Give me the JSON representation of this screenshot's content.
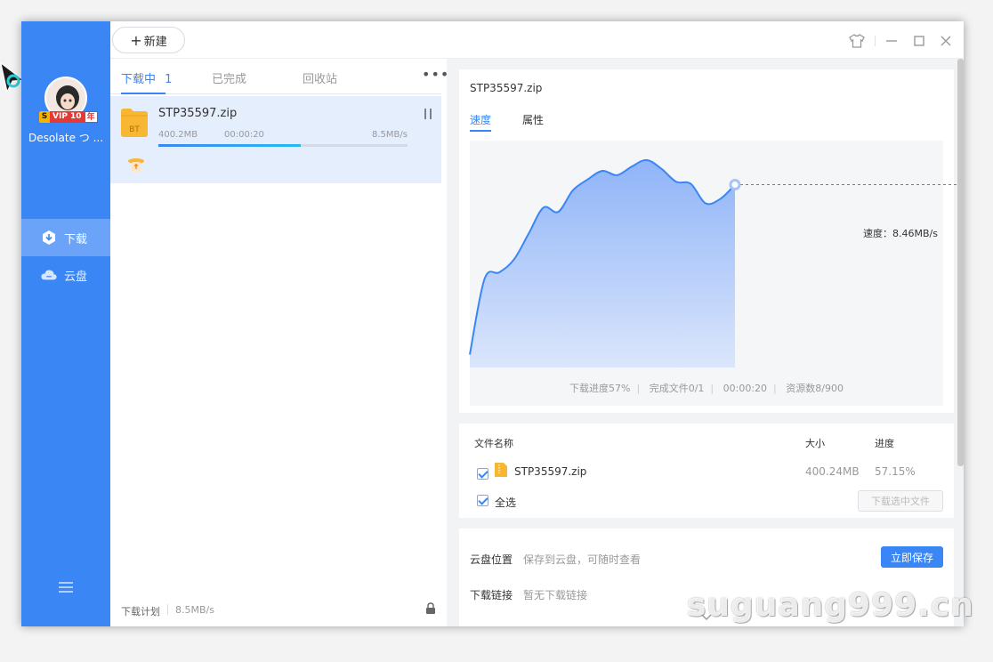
{
  "topbar": {
    "new_label": "新建"
  },
  "sidebar": {
    "username": "Desolate つ ...",
    "vip": {
      "s": "S",
      "text": "VIP 10",
      "year": "年"
    },
    "items": [
      {
        "label": "下载",
        "icon": "download-icon",
        "active": true
      },
      {
        "label": "云盘",
        "icon": "cloud-icon",
        "active": false
      }
    ]
  },
  "list": {
    "tabs": [
      {
        "label": "下载中",
        "count": "1",
        "active": true
      },
      {
        "label": "已完成",
        "active": false
      },
      {
        "label": "回收站",
        "active": false
      }
    ],
    "more": "•••",
    "item": {
      "name": "STP35597.zip",
      "size": "400.2MB",
      "time": "00:00:20",
      "speed": "8.5MB/s",
      "progress": 0.57,
      "file_badge": "BT"
    },
    "footer": {
      "plan": "下载计划",
      "speed": "8.5MB/s"
    }
  },
  "detail": {
    "title": "STP35597.zip",
    "tabs": [
      {
        "label": "速度",
        "active": true
      },
      {
        "label": "属性",
        "active": false
      }
    ],
    "speed_label": "速度：8.46MB/s",
    "stats": {
      "progress": "下载进度57%",
      "files": "完成文件0/1",
      "time": "00:00:20",
      "resources": "资源数8/900"
    },
    "files": {
      "headers": {
        "name": "文件名称",
        "size": "大小",
        "progress": "进度"
      },
      "rows": [
        {
          "name": "STP35597.zip",
          "size": "400.24MB",
          "progress": "57.15%"
        }
      ],
      "select_all": "全选",
      "download_selected": "下载选中文件"
    },
    "cloud": {
      "location_label": "云盘位置",
      "location_hint": "保存到云盘，可随时查看",
      "save_button": "立即保存",
      "link_label": "下载链接",
      "link_value": "暂无下载链接"
    }
  },
  "watermark": "suguang999.cn",
  "colors": {
    "accent": "#3a86f5",
    "sidebar": "#3a86f5",
    "chart_fill": "#a9c6f9"
  },
  "chart_data": {
    "type": "area",
    "title": "",
    "xlabel": "",
    "ylabel": "",
    "x": [
      0,
      1,
      2,
      3,
      4,
      5,
      6,
      7,
      8,
      9,
      10,
      11,
      12,
      13,
      14,
      15,
      16,
      17,
      18,
      19,
      20
    ],
    "y": [
      0.6,
      4.1,
      4.4,
      5.0,
      6.2,
      7.4,
      7.2,
      8.2,
      8.7,
      9.1,
      8.9,
      9.3,
      9.6,
      9.2,
      8.6,
      8.5,
      7.6,
      7.8,
      8.46,
      8.46,
      8.46
    ],
    "current": 8.46,
    "ylim": [
      0,
      10.5
    ],
    "grid": false
  }
}
